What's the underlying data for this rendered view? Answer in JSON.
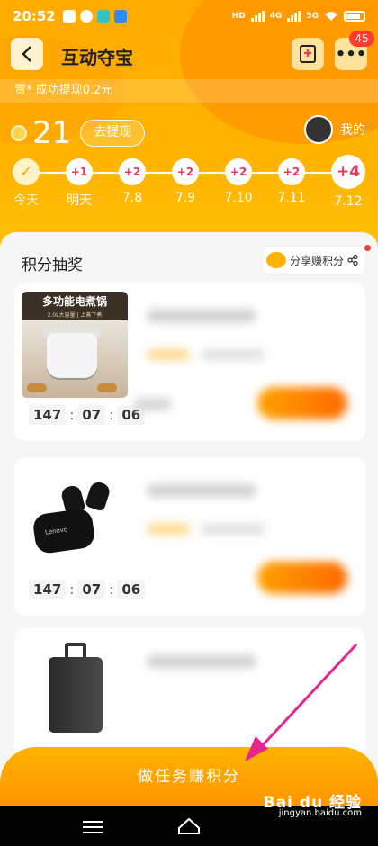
{
  "status_bar": {
    "time": "20:52",
    "network_labels": [
      "HD",
      "4G",
      "5G"
    ]
  },
  "header": {
    "title": "互动夺宝",
    "notification_count": "45",
    "ticker": "贾* 成功提现0.2元"
  },
  "points": {
    "value": "21",
    "withdraw_label": "去提现",
    "mine_label": "我的"
  },
  "checkin": [
    {
      "reward": "✓",
      "date": "今天",
      "done": true
    },
    {
      "reward": "+1",
      "date": "明天"
    },
    {
      "reward": "+2",
      "date": "7.8"
    },
    {
      "reward": "+2",
      "date": "7.9"
    },
    {
      "reward": "+2",
      "date": "7.10"
    },
    {
      "reward": "+2",
      "date": "7.11"
    },
    {
      "reward": "+4",
      "date": "7.12",
      "big": true
    }
  ],
  "lottery": {
    "title": "积分抽奖",
    "share_label": "分享赚积分",
    "products": [
      {
        "image_caption": "多功能电煮锅",
        "image_subcaption": "2.0L大容量 | 上蒸下煮",
        "timer": [
          "147",
          "07",
          "06"
        ]
      },
      {
        "image_caption": "Lenovo",
        "timer": [
          "147",
          "07",
          "06"
        ]
      },
      {
        "image_caption": ""
      }
    ]
  },
  "cta_label": "做任务赚积分",
  "watermark": {
    "line1": "Bai du 经验",
    "line2": "jingyan.baidu.com"
  },
  "colors": {
    "brand": "#ffb300",
    "accent_red": "#e5395b",
    "annotation_arrow": "#e6268c"
  }
}
